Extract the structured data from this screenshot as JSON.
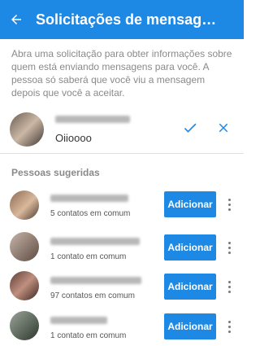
{
  "appbar": {
    "title": "Solicitações de mensag…",
    "back_icon": "arrow-left-icon",
    "color": "#1e88e5"
  },
  "info_text": "Abra uma solicitação para obter informações sobre quem está enviando mensagens para você. A pessoa só saberá que você viu a mensagem depois que você a aceitar.",
  "request": {
    "message_preview": "Oiioooo",
    "accept_icon": "check-icon",
    "decline_icon": "close-icon"
  },
  "suggested": {
    "section_title": "Pessoas sugeridas",
    "button_label": "Adicionar",
    "people": [
      {
        "mutual": "5 contatos em comum"
      },
      {
        "mutual": "1 contato em comum"
      },
      {
        "mutual": "97 contatos em comum"
      },
      {
        "mutual": "1 contato em comum"
      }
    ]
  }
}
